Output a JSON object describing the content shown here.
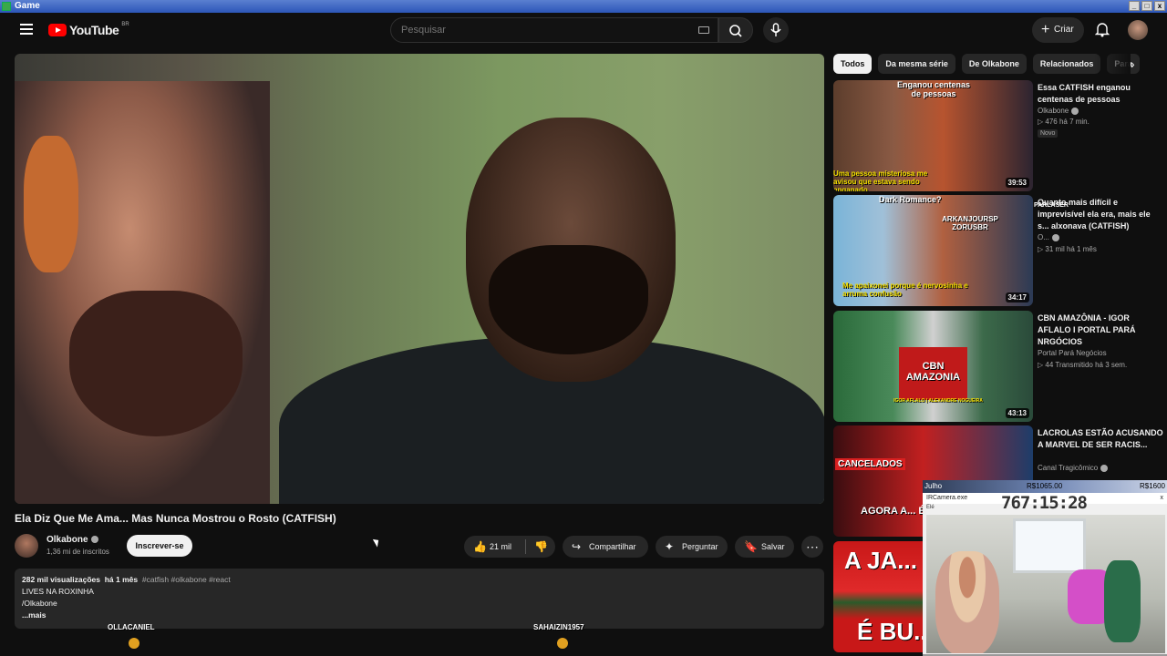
{
  "window": {
    "title": "Game",
    "buttons": [
      "_",
      "□",
      "x"
    ]
  },
  "header": {
    "logo_text": "YouTube",
    "logo_region": "BR",
    "search_placeholder": "Pesquisar",
    "create_label": "Criar"
  },
  "video": {
    "title": "Ela Diz Que Me Ama... Mas Nunca Mostrou o Rosto (CATFISH)",
    "channel": "Olkabone",
    "subscribers": "1,36 mi de inscritos",
    "subscribe_label": "Inscrever-se",
    "likes": "21 mil",
    "share_label": "Compartilhar",
    "ask_label": "Perguntar",
    "save_label": "Salvar",
    "more_label": "⋯"
  },
  "description": {
    "views": "282 mil visualizações",
    "age": "há 1 mês",
    "tags": "#catfish #olkabone #react",
    "line1": "LIVES NA ROXINHA",
    "line2": "/Olkabone",
    "more": "...mais"
  },
  "overlay": {
    "names": [
      "OLLACANIEL",
      "SAHAIZIN1957"
    ]
  },
  "chips": [
    "Todos",
    "Da mesma série",
    "De Olkabone",
    "Relacionados",
    "Para"
  ],
  "recommendations": [
    {
      "title": "Essa CATFISH enganou centenas de pessoas",
      "channel": "Olkabone",
      "meta": "▷ 476  há 7 min.",
      "badge": "Novo",
      "duration": "39:53",
      "thumb_top": "Enganou centenas de pessoas",
      "thumb_bottom": "Uma pessoa misteriosa me avisou que estava sendo enganado",
      "colors": [
        "#5c3d2c",
        "#b7542f",
        "#2c2430"
      ]
    },
    {
      "title": "Quanto mais difícil e imprevisível ela era, mais ele s... alxonava (CATFISH)",
      "channel": "O...",
      "meta": "▷ 31 mil  há 1 mês",
      "badge": "",
      "duration": "34:17",
      "thumb_top": "Dark Romance?",
      "thumb_mid": "ARKANJOURSP ZORUSBR",
      "thumb_bottom": "Me apaixonei porque é nervosinha e arruma confusão",
      "overlay_tag": "PARLASER",
      "colors": [
        "#7ab4d8",
        "#b06040",
        "#2b3a55"
      ]
    },
    {
      "title": "CBN AMAZÔNIA - IGOR AFLALO I PORTAL PARÁ NRGÓCIOS",
      "channel": "Portal Pará Negócios",
      "meta": "▷ 44  Transmitido há 3 sem.",
      "badge": "",
      "duration": "43:13",
      "thumb_mid": "CBN AMAZONIA",
      "thumb_bottom": "IGOR AFLALO | ALEXANDRE NOGUEIRA",
      "colors": [
        "#2a6a3a",
        "#d0d0d0",
        "#d92020"
      ]
    },
    {
      "title": "LACROLAS ESTÃO ACUSANDO A MARVEL DE SER RACIS...",
      "channel": "Canal Tragicômico",
      "meta": "",
      "badge": "",
      "duration": "",
      "thumb_top": "CANCELADOS",
      "thumb_bottom": "AGORA A... É R@CIST...",
      "colors": [
        "#3a0d10",
        "#c22020",
        "#1d3d6a"
      ]
    },
    {
      "title": "",
      "channel": "",
      "meta": "",
      "badge": "",
      "duration": "",
      "thumb_top": "A JA...",
      "thumb_bottom": "É BU...",
      "colors": [
        "#c81818",
        "#e02a2a",
        "#2a5a2a"
      ]
    }
  ],
  "obs": {
    "goal_label": "Julho",
    "goal_current": "R$1065.00",
    "goal_target": "R$1600",
    "cam_label": "IRCamera.exe",
    "cam_close": "x",
    "timer": "767:15:28",
    "small_label": "Elé"
  }
}
